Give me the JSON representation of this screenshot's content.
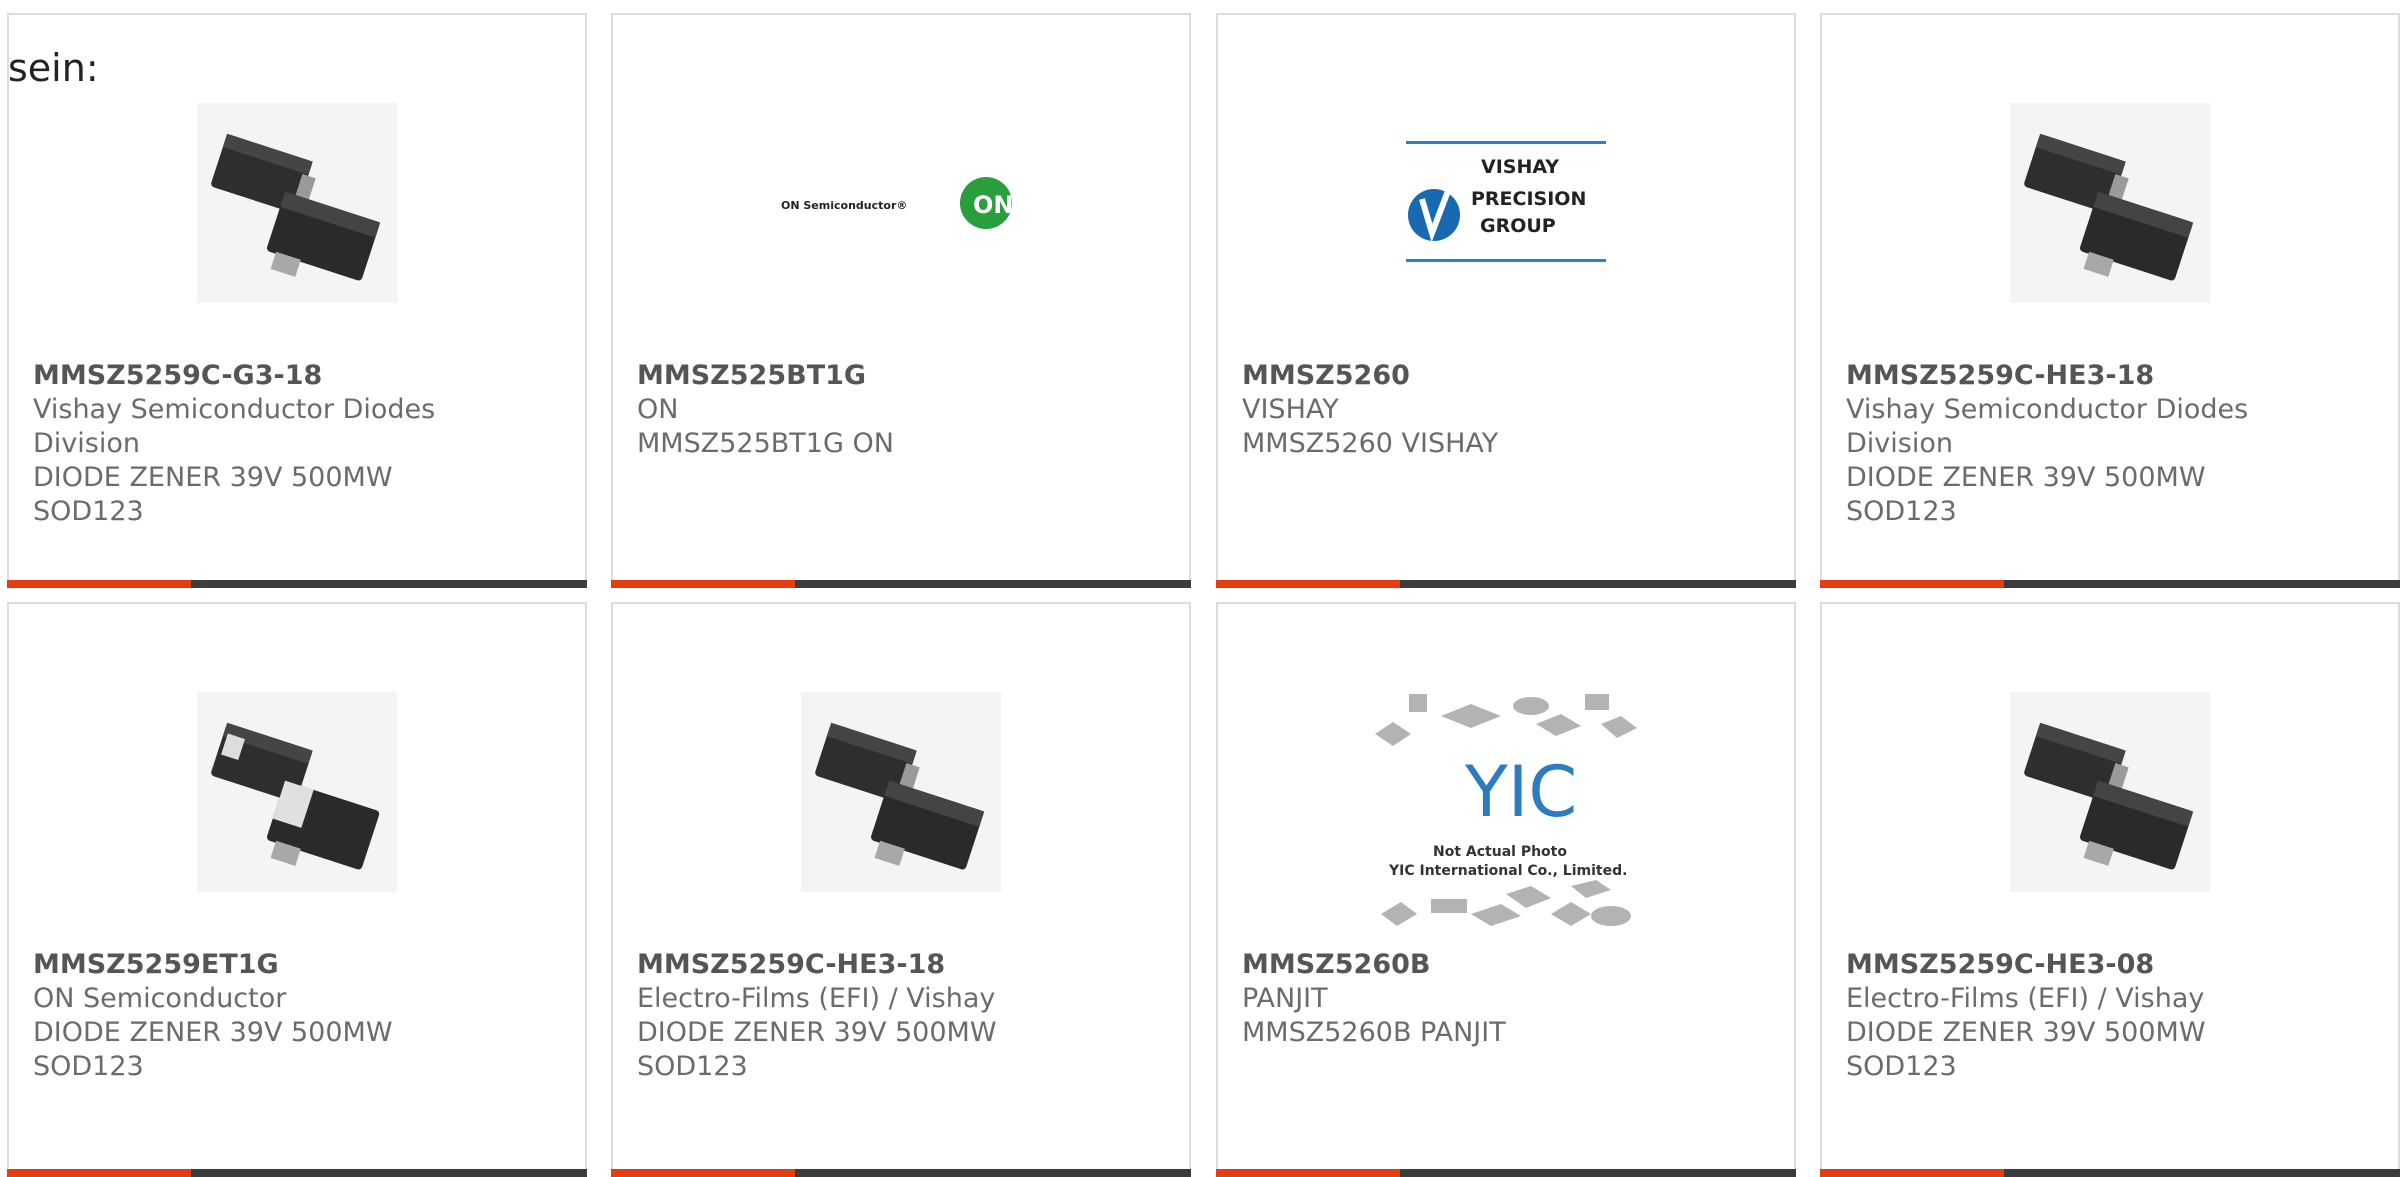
{
  "lead_text": "sein:",
  "accent_color": "#e43d12",
  "bar_color": "#3c3c3c",
  "cards": [
    {
      "part": "MMSZ5259C-G3-18",
      "maker": "Vishay Semiconductor Diodes Division",
      "desc": "DIODE ZENER 39V 500MW",
      "desc2": "SOD123",
      "image": "sod123-diode-image"
    },
    {
      "part": "MMSZ525BT1G",
      "maker": "ON",
      "desc": "MMSZ525BT1G ON",
      "desc2": "",
      "image": "on-semiconductor-logo",
      "logo_text": "ON Semiconductor®",
      "logo_badge": "ON"
    },
    {
      "part": "MMSZ5260",
      "maker": "VISHAY",
      "desc": "MMSZ5260 VISHAY",
      "desc2": "",
      "image": "vishay-precision-group-logo",
      "logo_lines": [
        "VISHAY",
        "PRECISION",
        "GROUP"
      ]
    },
    {
      "part": "MMSZ5259C-HE3-18",
      "maker": "Vishay Semiconductor Diodes Division",
      "desc": "DIODE ZENER 39V 500MW",
      "desc2": "SOD123",
      "image": "sod123-diode-image"
    },
    {
      "part": "MMSZ5259ET1G",
      "maker": "ON Semiconductor",
      "desc": "DIODE ZENER 39V 500MW",
      "desc2": "SOD123",
      "image": "sod123-diode-image"
    },
    {
      "part": "MMSZ5259C-HE3-18",
      "maker": "Electro-Films (EFI) / Vishay",
      "desc": "DIODE ZENER 39V 500MW",
      "desc2": "SOD123",
      "image": "sod123-diode-image"
    },
    {
      "part": "MMSZ5260B",
      "maker": "PANJIT",
      "desc": "MMSZ5260B PANJIT",
      "desc2": "",
      "image": "yic-placeholder-image",
      "logo_text": "YIC",
      "note1": "Not Actual Photo",
      "note2": "YIC International Co., Limited."
    },
    {
      "part": "MMSZ5259C-HE3-08",
      "maker": "Electro-Films (EFI) / Vishay",
      "desc": "DIODE ZENER 39V 500MW",
      "desc2": "SOD123",
      "image": "sod123-diode-image"
    }
  ]
}
